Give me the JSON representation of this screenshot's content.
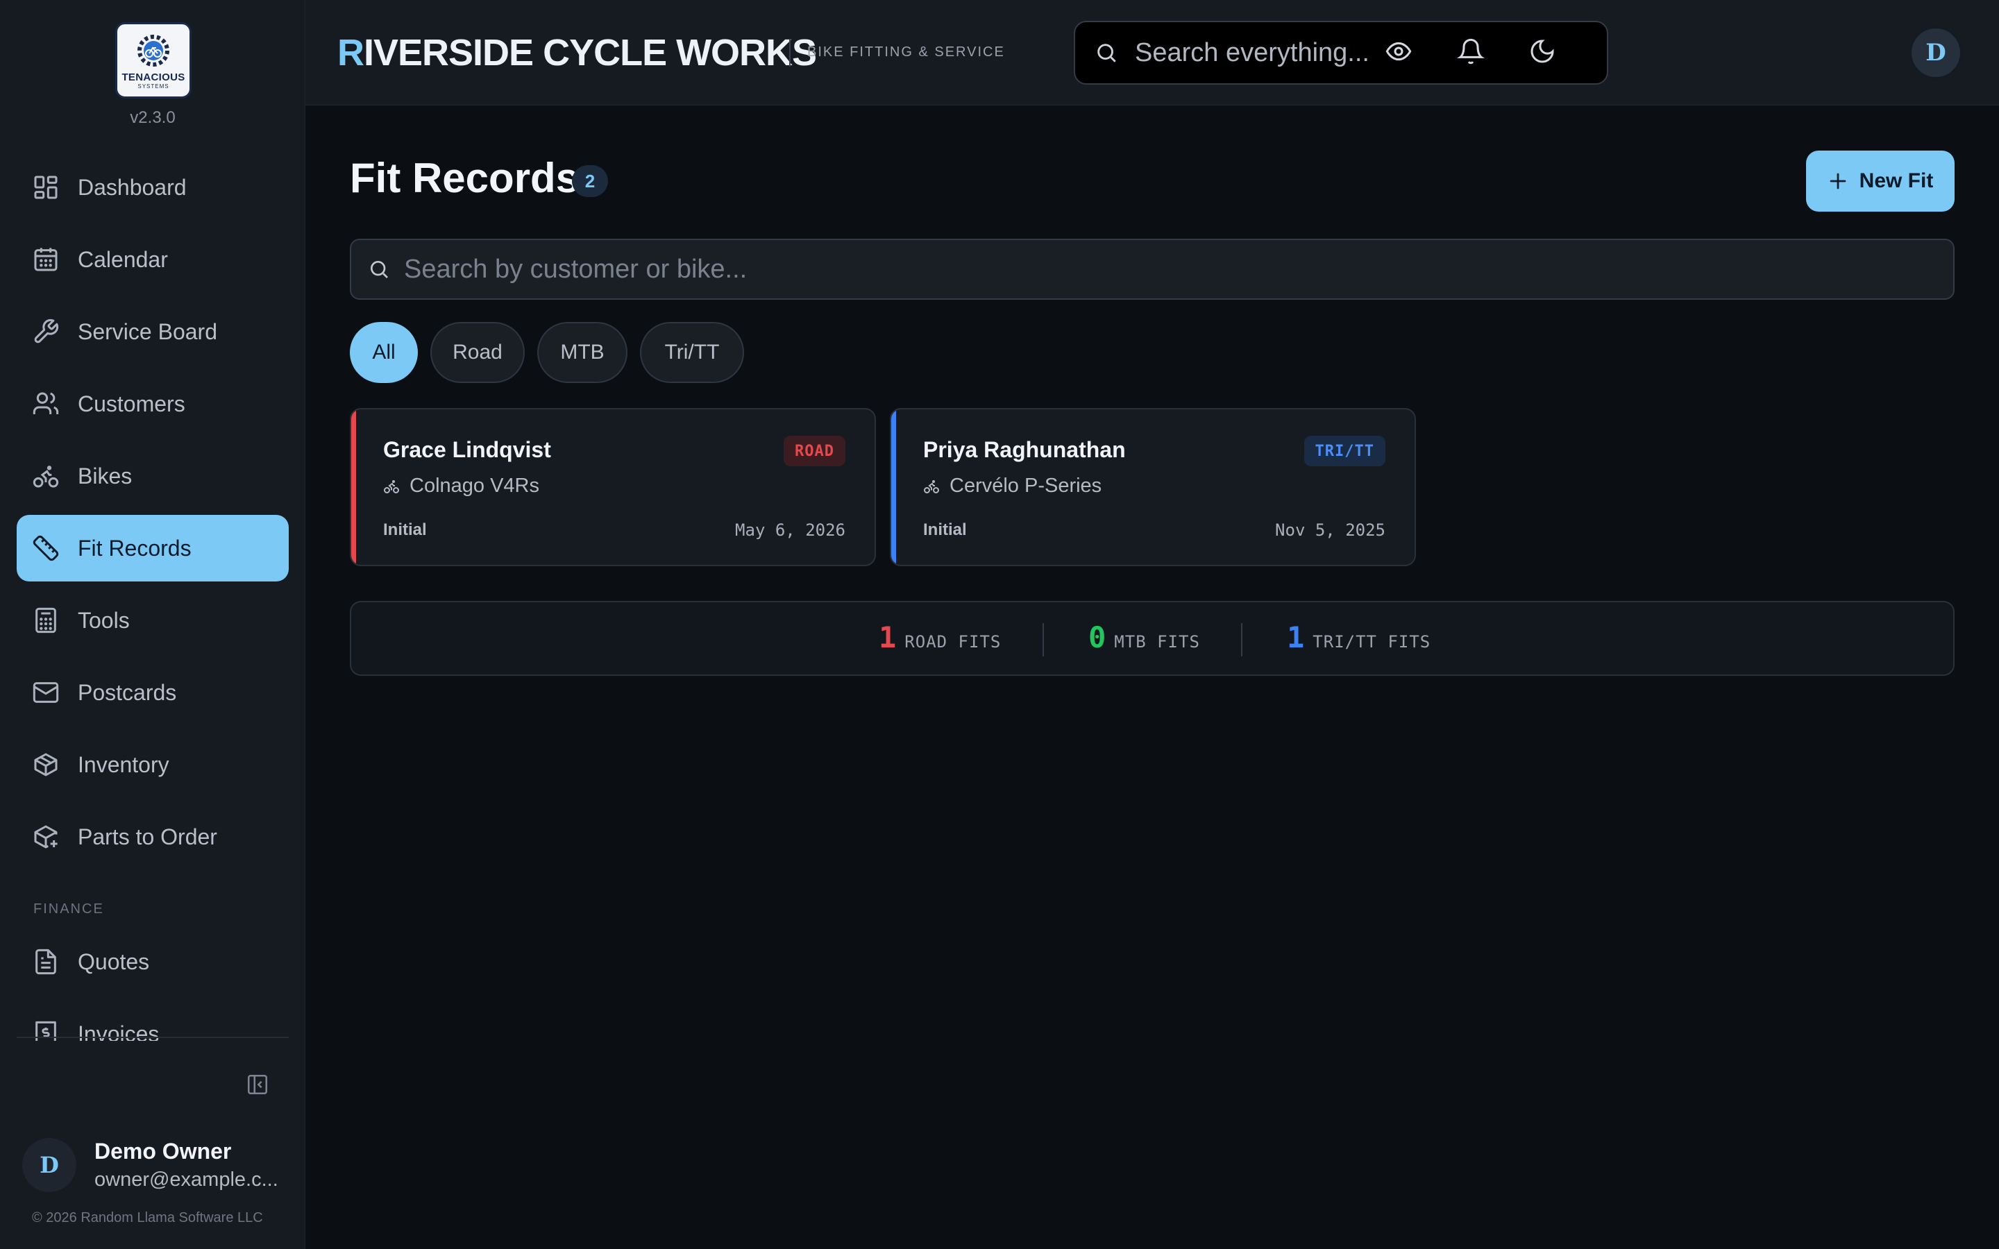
{
  "sidebar": {
    "logo": {
      "word": "TENACIOUS",
      "sub": "SYSTEMS"
    },
    "version": "v2.3.0",
    "items": [
      {
        "label": "Dashboard",
        "icon": "dashboard-icon"
      },
      {
        "label": "Calendar",
        "icon": "calendar-icon"
      },
      {
        "label": "Service Board",
        "icon": "wrench-icon"
      },
      {
        "label": "Customers",
        "icon": "users-icon"
      },
      {
        "label": "Bikes",
        "icon": "bike-icon"
      },
      {
        "label": "Fit Records",
        "icon": "ruler-icon",
        "active": true
      },
      {
        "label": "Tools",
        "icon": "calculator-icon"
      },
      {
        "label": "Postcards",
        "icon": "mail-icon"
      },
      {
        "label": "Inventory",
        "icon": "box-icon"
      },
      {
        "label": "Parts to Order",
        "icon": "package-plus-icon"
      }
    ],
    "finance_section": "FINANCE",
    "finance_items": [
      {
        "label": "Quotes",
        "icon": "document-icon"
      },
      {
        "label": "Invoices",
        "icon": "invoice-icon"
      }
    ],
    "user": {
      "initial": "D",
      "name": "Demo Owner",
      "email": "owner@example.c..."
    },
    "copyright": "© 2026 Random Llama Software LLC"
  },
  "header": {
    "brand_first": "R",
    "brand_rest": "IVERSIDE CYCLE WORKS",
    "tagline": "BIKE FITTING & SERVICE",
    "search_placeholder": "Search everything...",
    "user_initial": "D"
  },
  "main": {
    "title": "Fit Records",
    "count": "2",
    "new_button": "New Fit",
    "search_placeholder": "Search by customer or bike...",
    "filters": [
      {
        "label": "All",
        "active": true
      },
      {
        "label": "Road"
      },
      {
        "label": "MTB"
      },
      {
        "label": "Tri/TT"
      }
    ],
    "cards": [
      {
        "name": "Grace Lindqvist",
        "tag": "ROAD",
        "bike": "Colnago V4Rs",
        "type": "Initial",
        "date": "May 6, 2026",
        "accent": "#e5484d",
        "tag_bg": "#3a1c21",
        "tag_fg": "#e5484d"
      },
      {
        "name": "Priya Raghunathan",
        "tag": "TRI/TT",
        "bike": "Cervélo P-Series",
        "type": "Initial",
        "date": "Nov 5, 2025",
        "accent": "#3b82f6",
        "tag_bg": "#1a2b46",
        "tag_fg": "#4b8ef7"
      }
    ],
    "stats": [
      {
        "value": "1",
        "label": "ROAD FITS",
        "color": "#e5484d"
      },
      {
        "value": "0",
        "label": "MTB FITS",
        "color": "#22c55e"
      },
      {
        "value": "1",
        "label": "TRI/TT FITS",
        "color": "#3b82f6"
      }
    ]
  },
  "colors": {
    "accent": "#7cc9f5",
    "background": "#0b0f14",
    "panel": "#161b22"
  }
}
